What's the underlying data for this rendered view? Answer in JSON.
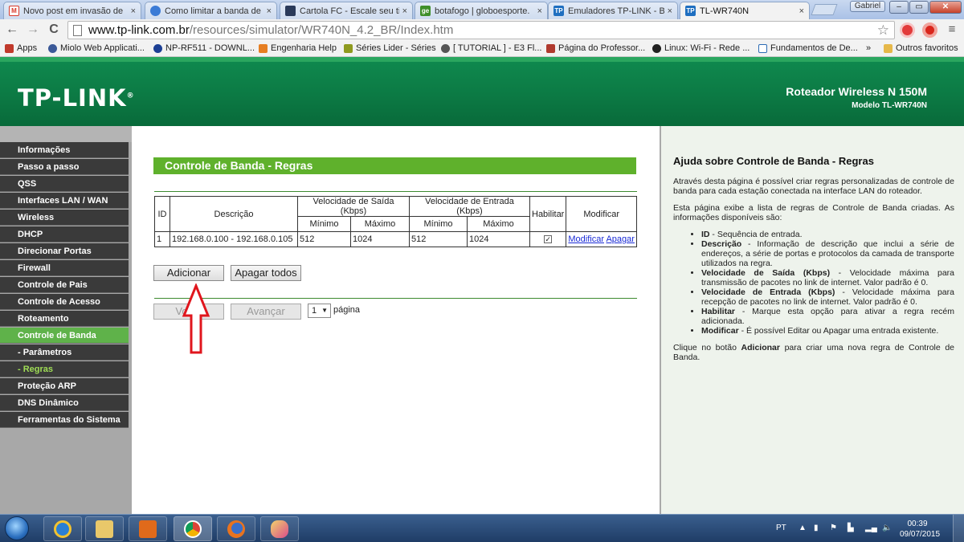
{
  "browser": {
    "tabs": [
      {
        "title": "Novo post em invasão de",
        "fav_color": "#d93a2b",
        "fav_glyph": "M"
      },
      {
        "title": "Como limitar a banda de",
        "fav_color": "#3b7bd6",
        "fav_glyph": ""
      },
      {
        "title": "Cartola FC - Escale seu tir",
        "fav_color": "#2a3a5a",
        "fav_glyph": ""
      },
      {
        "title": "botafogo | globoesporte.",
        "fav_color": "#3f8f2a",
        "fav_glyph": "ge"
      },
      {
        "title": "Emuladores TP-LINK - Be",
        "fav_color": "#1f6fc0",
        "fav_glyph": "TP"
      },
      {
        "title": "TL-WR740N",
        "fav_color": "#1f6fc0",
        "fav_glyph": "TP"
      }
    ],
    "tab_close": "×",
    "user_label": "Gabriel",
    "window_buttons": {
      "minimize": "–",
      "maximize": "▭",
      "close": "✕"
    },
    "address": {
      "host": "www.tp-link.com.br",
      "path": "/resources/simulator/WR740N_4.2_BR/Index.htm"
    },
    "nav": {
      "back": "←",
      "forward": "→",
      "reload": "C"
    },
    "bookmarks": [
      {
        "label": "Apps",
        "color": "#c0392b"
      },
      {
        "label": "Miolo Web Applicati...",
        "color": "#3b5998"
      },
      {
        "label": "NP-RF511 - DOWNL...",
        "color": "#1c3f94"
      },
      {
        "label": "Engenharia Help",
        "color": "#e67e22"
      },
      {
        "label": "Séries Lider - Séries",
        "color": "#8e9a1f"
      },
      {
        "label": "[ TUTORIAL ] - E3 Fl...",
        "color": "#555555"
      },
      {
        "label": "Página do Professor...",
        "color": "#b03a2e"
      },
      {
        "label": "Linux: Wi-Fi - Rede ...",
        "color": "#222222"
      },
      {
        "label": "Fundamentos de De...",
        "color": "#2c6bb4"
      },
      {
        "label": "»",
        "color": ""
      },
      {
        "label": "Outros favoritos",
        "color": "#e6b84a"
      }
    ]
  },
  "header": {
    "logo": "TP-LINK",
    "logo_mark": "®",
    "product": "Roteador Wireless N 150M",
    "model": "Modelo TL-WR740N"
  },
  "menu": [
    {
      "label": "Informações",
      "state": "normal"
    },
    {
      "label": "Passo a passo",
      "state": "normal"
    },
    {
      "label": "QSS",
      "state": "normal"
    },
    {
      "label": "Interfaces LAN / WAN",
      "state": "normal"
    },
    {
      "label": "Wireless",
      "state": "normal"
    },
    {
      "label": "DHCP",
      "state": "normal"
    },
    {
      "label": "Direcionar Portas",
      "state": "normal"
    },
    {
      "label": "Firewall",
      "state": "normal"
    },
    {
      "label": "Controle de Pais",
      "state": "normal"
    },
    {
      "label": "Controle de Acesso",
      "state": "normal"
    },
    {
      "label": "Roteamento",
      "state": "normal"
    },
    {
      "label": "Controle de Banda",
      "state": "active"
    },
    {
      "label": "- Parâmetros",
      "state": "sub"
    },
    {
      "label": "- Regras",
      "state": "subactive"
    },
    {
      "label": "Proteção ARP",
      "state": "normal"
    },
    {
      "label": "DNS Dinâmico",
      "state": "normal"
    },
    {
      "label": "Ferramentas do Sistema",
      "state": "normal"
    }
  ],
  "content": {
    "section_title": "Controle de Banda - Regras",
    "table": {
      "headers": {
        "id": "ID",
        "descricao": "Descrição",
        "saida": "Velocidade de Saída (Kbps)",
        "entrada": "Velocidade de Entrada (Kbps)",
        "habilitar": "Habilitar",
        "modificar": "Modificar",
        "minimo": "Mínimo",
        "maximo": "Máximo"
      },
      "rows": [
        {
          "id": "1",
          "descricao": "192.168.0.100 - 192.168.0.105",
          "saida_min": "512",
          "saida_max": "1024",
          "entrada_min": "512",
          "entrada_max": "1024",
          "habilitado": "✓",
          "link_modificar": "Modificar",
          "link_apagar": "Apagar"
        }
      ]
    },
    "buttons": {
      "adicionar": "Adicionar",
      "apagar_todos": "Apagar todos",
      "voltar": "Voltar",
      "avancar": "Avançar"
    },
    "page_select": "1",
    "page_label": "página"
  },
  "help": {
    "title": "Ajuda sobre Controle de Banda - Regras",
    "p1": "Através desta página é possível criar regras personalizadas de controle de banda para cada estação conectada na interface LAN do roteador.",
    "p2": "Esta página exibe a lista de regras de Controle de Banda criadas. As informações disponíveis são:",
    "items": [
      {
        "term": "ID",
        "text": " - Sequência de entrada."
      },
      {
        "term": "Descrição",
        "text": " - Informação de descrição que inclui a série de endereços, a série de portas e protocolos da camada de transporte utilizados na regra."
      },
      {
        "term": "Velocidade de Saída (Kbps)",
        "text": " - Velocidade máxima para transmissão de pacotes no link de internet. Valor padrão é 0."
      },
      {
        "term": "Velocidade de Entrada (Kbps)",
        "text": " - Velocidade máxima para recepção de pacotes no link de internet. Valor padrão é 0."
      },
      {
        "term": "Habilitar",
        "text": " - Marque esta opção para ativar a regra recém adicionada."
      },
      {
        "term": "Modificar",
        "text": " - É possível Editar ou Apagar uma entrada existente."
      }
    ],
    "p3_pre": "Clique no botão ",
    "p3_bold": "Adicionar",
    "p3_post": " para criar uma nova regra de Controle de Banda."
  },
  "taskbar": {
    "language": "PT",
    "time": "00:39",
    "date": "09/07/2015",
    "apps": [
      "internet-explorer",
      "file-explorer",
      "media-player",
      "chrome",
      "firefox",
      "paint"
    ]
  },
  "annotation": {
    "arrow_color": "#e0161d"
  }
}
